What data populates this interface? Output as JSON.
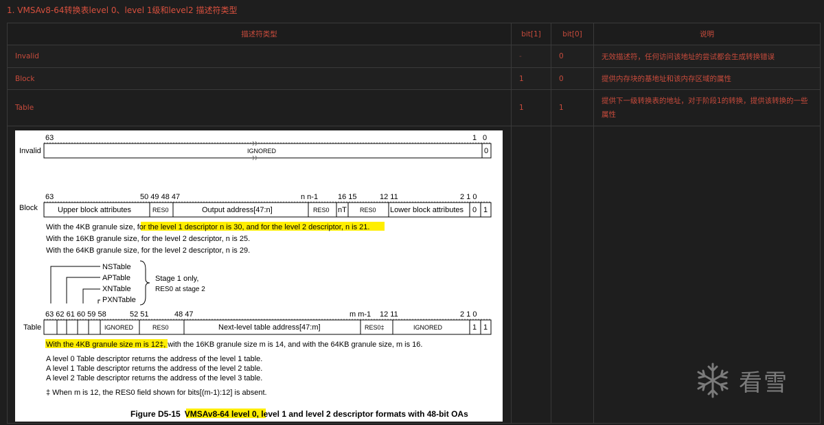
{
  "heading": "1. VMSAv8-64转换表level 0、level 1级和level2 描述符类型",
  "table": {
    "headers": [
      "描述符类型",
      "bit[1]",
      "bit[0]",
      "说明"
    ],
    "rows": [
      {
        "type": "Invalid",
        "bit1": "-",
        "bit0": "0",
        "desc": "无效描述符，任何访问该地址的尝试都会生成转换错误"
      },
      {
        "type": "Block",
        "bit1": "1",
        "bit0": "0",
        "desc": "提供内存块的基地址和该内存区域的属性"
      },
      {
        "type": "Table",
        "bit1": "1",
        "bit0": "1",
        "desc": "提供下一级转换表的地址，对于阶段1的转换，提供该转换的一些属性"
      }
    ]
  },
  "figure": {
    "invalid": {
      "label": "Invalid",
      "hi": "63",
      "b1": "1",
      "b0": "0",
      "field": "IGNORED",
      "last": "0"
    },
    "block": {
      "label": "Block",
      "bits": [
        "63",
        "50 49 48 47",
        "n n-1",
        "16 15",
        "12 11",
        "2 1 0"
      ],
      "fields": [
        "Upper block attributes",
        "RES0",
        "Output address[47:n]",
        "RES0",
        "nT",
        "RES0",
        "Lower block attributes",
        "0",
        "1"
      ],
      "notes": [
        "With the 4KB granule size, ",
        "for the level 1 descriptor n is 30, and for the level 2 descriptor, n is 21",
        ".",
        "With the 16KB granule size, for the level 2 descriptor, n is 25.",
        "With the 64KB granule size, for the level 2 descriptor, n is 29."
      ]
    },
    "bracket": {
      "items": [
        "NSTable",
        "APTable",
        "XNTable",
        "PXNTable"
      ],
      "note1": "Stage 1 only,",
      "note2": "RES0 at stage 2"
    },
    "table": {
      "label": "Table",
      "bits": [
        "63 62 61 60 59 58",
        "52 51",
        "48 47",
        "m m-1",
        "12 11",
        "2 1 0"
      ],
      "fields": [
        "IGNORED",
        "RES0",
        "Next-level table address[47:m]",
        "RES0‡",
        "IGNORED",
        "1",
        "1"
      ],
      "note_hl": "With the 4KB granule size m is 12‡",
      "note_rest": ", with the 16KB granule size m is 14, and with the 64KB granule size, m is 16.",
      "lines": [
        "A level 0 Table descriptor returns the address of the level 1 table.",
        "A level 1 Table descriptor returns the address of the level 2 table.",
        "A level 2 Table descriptor returns the address of the level 3 table."
      ],
      "footnote": "‡ When m is 12, the RES0 field shown for bits[(m-1):12] is absent."
    },
    "caption_pre": "Figure D5-15",
    "caption_hl": "VMSAv8-64 level 0",
    "caption_post": ", level 1 and level 2 descriptor formats with 48-bit OAs"
  },
  "watermark": "看雪",
  "colors": {
    "text_red": "#c84b3c",
    "highlight": "#ffee00",
    "bg": "#1e1e1e"
  }
}
